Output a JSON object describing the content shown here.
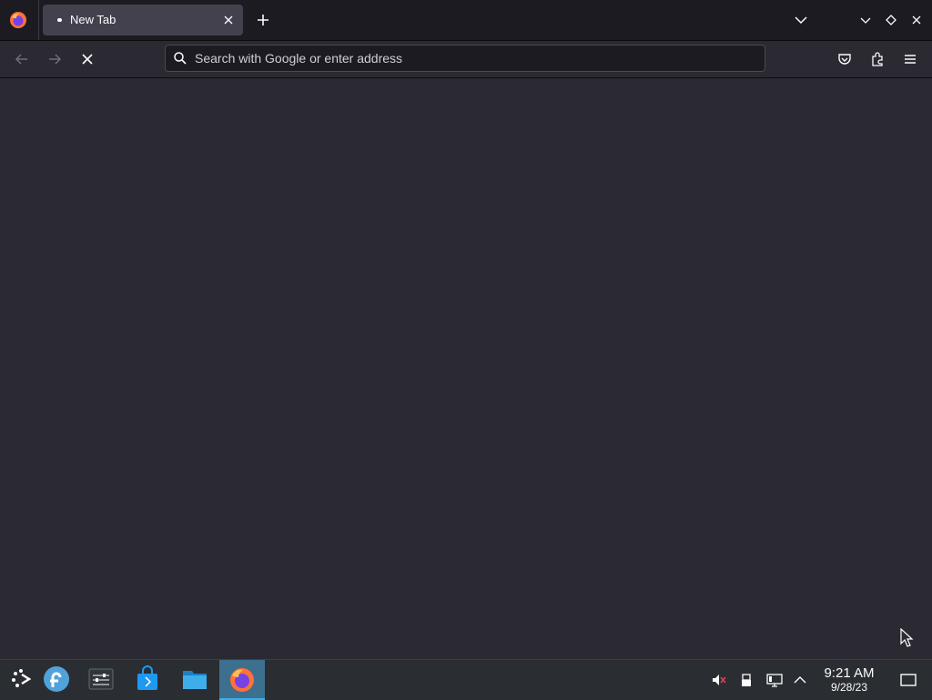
{
  "browser": {
    "tab": {
      "title": "New Tab"
    },
    "urlbar": {
      "placeholder": "Search with Google or enter address",
      "value": ""
    }
  },
  "taskbar": {
    "clock": {
      "time": "9:21 AM",
      "date": "9/28/23"
    }
  },
  "colors": {
    "content_bg": "#2b2a33",
    "tabstrip_bg": "#1c1b22",
    "taskbar_bg": "#2a2e32",
    "active_task": "#3d6f8f"
  },
  "icons": [
    "firefox-icon",
    "close-icon",
    "plus-icon",
    "chevron-down-icon",
    "maximize-icon",
    "back-arrow-icon",
    "forward-arrow-icon",
    "stop-icon",
    "search-icon",
    "pocket-icon",
    "extensions-icon",
    "menu-icon",
    "launcher-icon",
    "fedora-icon",
    "settings-icon",
    "discover-icon",
    "folder-icon",
    "mute-icon",
    "usb-icon",
    "network-icon",
    "chevron-up-icon",
    "desktop-icon"
  ]
}
